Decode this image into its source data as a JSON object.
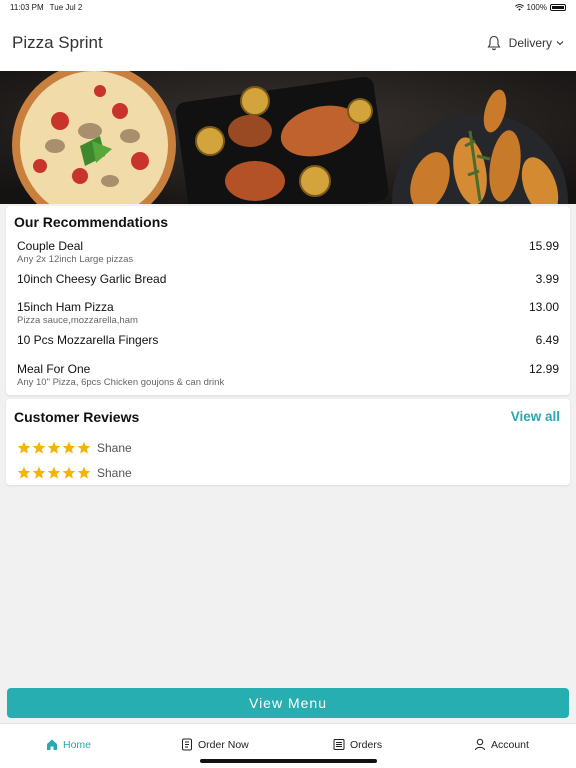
{
  "status_bar": {
    "time": "11:03 PM",
    "date": "Tue Jul 2",
    "battery": "100%"
  },
  "header": {
    "title": "Pizza Sprint",
    "mode": "Delivery"
  },
  "recommendations": {
    "title": "Our Recommendations",
    "items": [
      {
        "name": "Couple Deal",
        "desc": "Any 2x 12inch Large pizzas",
        "price": "15.99"
      },
      {
        "name": "10inch Cheesy Garlic Bread",
        "desc": "",
        "price": "3.99"
      },
      {
        "name": "15inch Ham Pizza",
        "desc": "Pizza sauce,mozzarella,ham",
        "price": "13.00"
      },
      {
        "name": "10 Pcs Mozzarella Fingers",
        "desc": "",
        "price": "6.49"
      },
      {
        "name": "Meal For One",
        "desc": "Any 10\" Pizza, 6pcs Chicken goujons & can drink",
        "price": "12.99"
      }
    ]
  },
  "reviews": {
    "title": "Customer Reviews",
    "view_all": "View all",
    "items": [
      {
        "name": "Shane",
        "rating": 5
      },
      {
        "name": "Shane",
        "rating": 5
      }
    ]
  },
  "view_menu": "View Menu",
  "tabs": [
    {
      "label": "Home",
      "icon": "home-icon",
      "active": true
    },
    {
      "label": "Order Now",
      "icon": "order-icon",
      "active": false
    },
    {
      "label": "Orders",
      "icon": "orders-icon",
      "active": false
    },
    {
      "label": "Account",
      "icon": "account-icon",
      "active": false
    }
  ],
  "colors": {
    "accent": "#27aeb1",
    "star": "#f5b400"
  }
}
